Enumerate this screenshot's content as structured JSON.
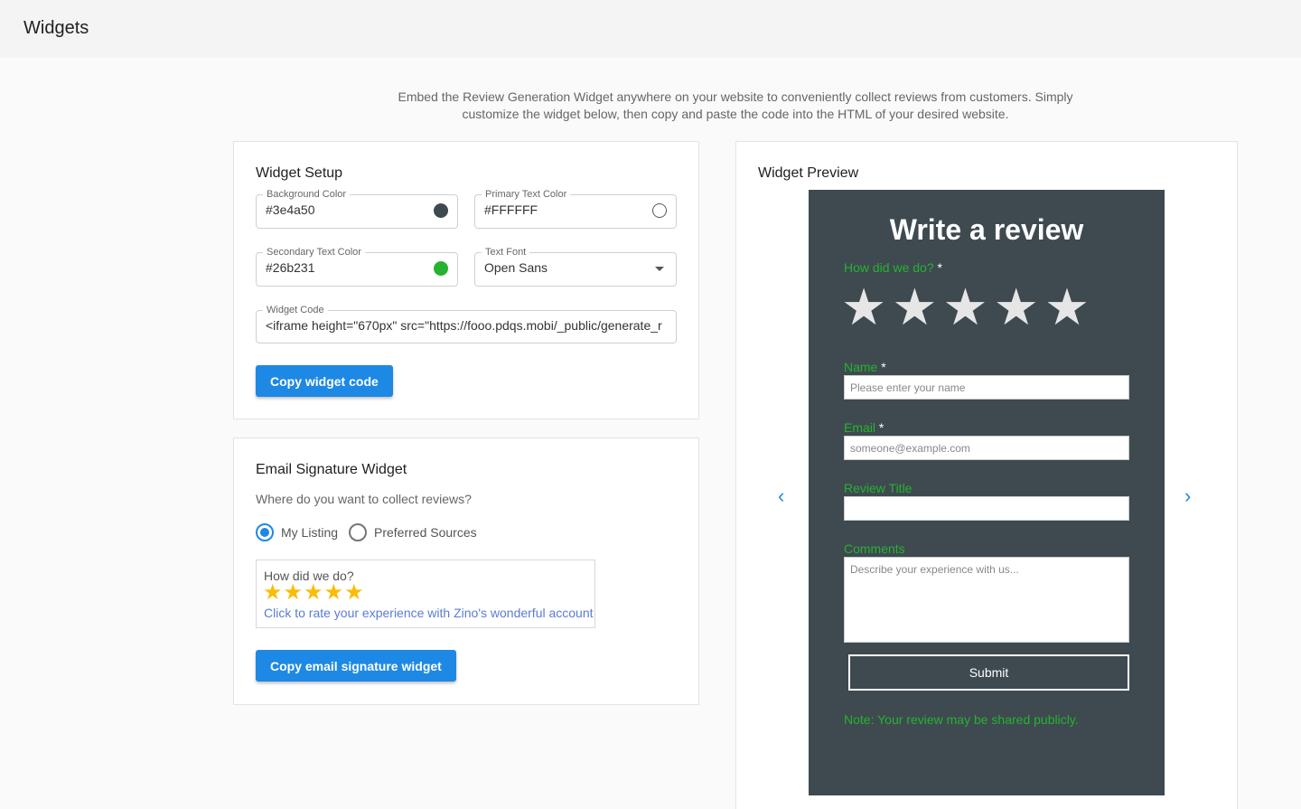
{
  "header": {
    "title": "Widgets"
  },
  "intro": "Embed the Review Generation Widget anywhere on your website to conveniently collect reviews from customers. Simply customize the widget below, then copy and paste the code into the HTML of your desired website.",
  "setup": {
    "title": "Widget Setup",
    "background_color": {
      "label": "Background Color",
      "value": "#3e4a50"
    },
    "primary_text_color": {
      "label": "Primary Text Color",
      "value": "#FFFFFF"
    },
    "secondary_text_color": {
      "label": "Secondary Text Color",
      "value": "#26b231"
    },
    "text_font": {
      "label": "Text Font",
      "value": "Open Sans"
    },
    "widget_code": {
      "label": "Widget Code",
      "value": "<iframe height=\"670px\" src=\"https://fooo.pdqs.mobi/_public/generate_r"
    },
    "copy_button": "Copy widget code"
  },
  "email_signature": {
    "title": "Email Signature Widget",
    "question": "Where do you want to collect reviews?",
    "options": [
      {
        "label": "My Listing",
        "selected": true
      },
      {
        "label": "Preferred Sources",
        "selected": false
      }
    ],
    "sample": {
      "question": "How did we do?",
      "stars": "★★★★★",
      "link": "Click to rate your experience with Zino's wonderful account"
    },
    "copy_button": "Copy email signature widget"
  },
  "preview": {
    "title": "Widget Preview",
    "heading": "Write a review",
    "rating_label": "How did we do?",
    "required_mark": "*",
    "stars": "★★★★★",
    "name_label": "Name",
    "name_placeholder": "Please enter your name",
    "email_label": "Email",
    "email_placeholder": "someone@example.com",
    "review_title_label": "Review Title",
    "comments_label": "Comments",
    "comments_placeholder": "Describe your experience with us...",
    "submit": "Submit",
    "note": "Note: Your review may be shared publicly.",
    "prev_icon": "chevron-left-icon",
    "next_icon": "chevron-right-icon"
  },
  "colors": {
    "accent": "#1e88e5",
    "preview_background": "#3e4a50",
    "secondary_text": "#26b231",
    "star_gold": "#fbbc05"
  }
}
